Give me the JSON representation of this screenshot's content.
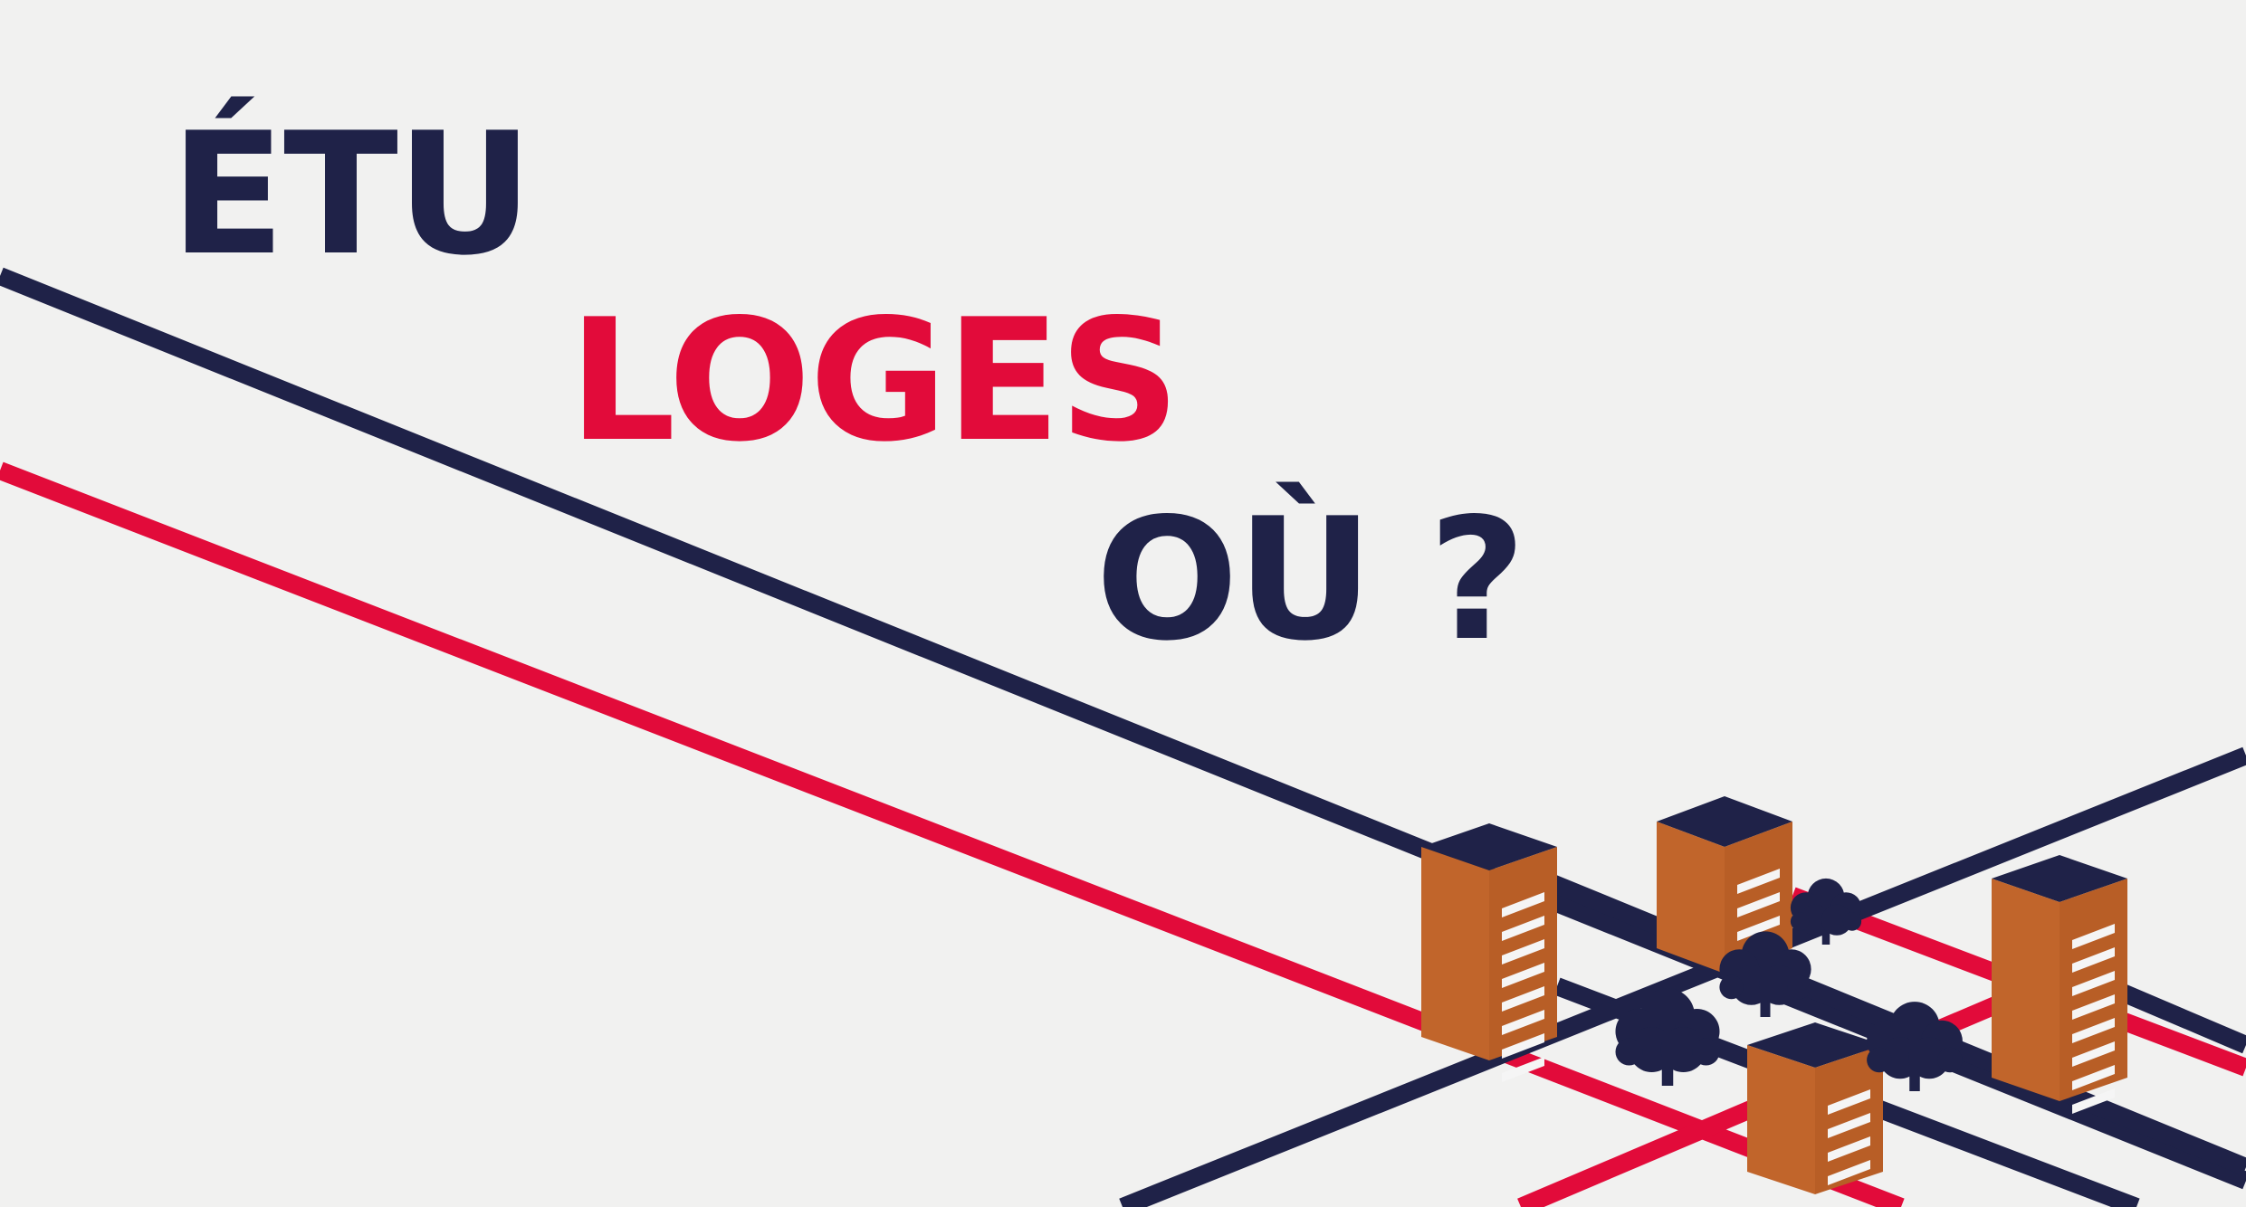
{
  "headline": {
    "line1": "ÉTU",
    "line2": "LOGES",
    "line3": "OÙ ?"
  },
  "colors": {
    "background": "#f1f1f0",
    "navy": "#1f2248",
    "red": "#e20b3a",
    "building_orange": "#c1652b",
    "window_white": "#f5f5f5"
  },
  "illustration": {
    "icons": [
      "road-lines",
      "building-icon",
      "tree-icon"
    ]
  }
}
